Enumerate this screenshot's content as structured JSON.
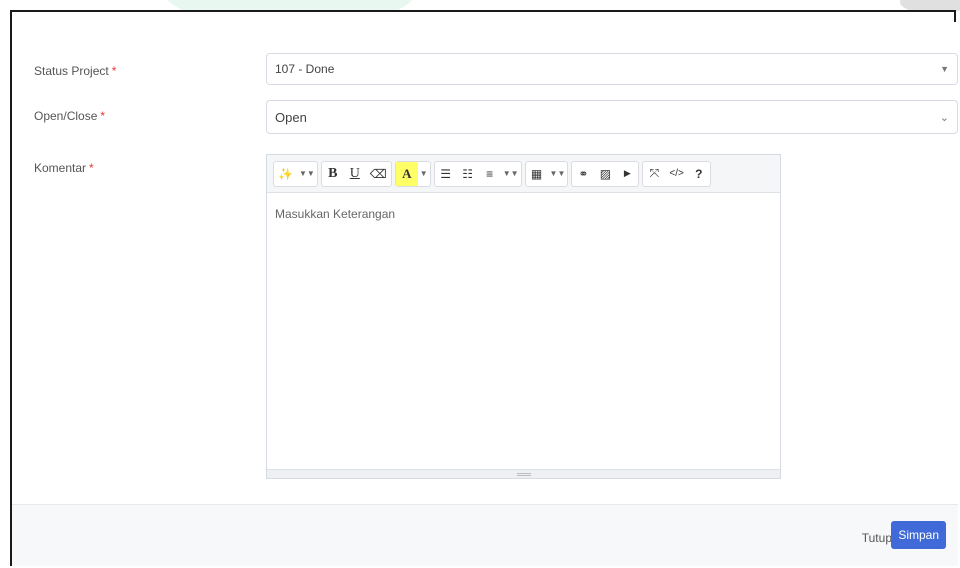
{
  "form": {
    "status_label": "Status Project",
    "status_value": "107 - Done",
    "openclose_label": "Open/Close",
    "openclose_value": "Open",
    "komentar_label": "Komentar",
    "required_mark": "*"
  },
  "editor": {
    "placeholder": "Masukkan Keterangan",
    "toolbar": {
      "style": "✨",
      "bold": "B",
      "underline": "U",
      "eraser": "⌫",
      "highlight": "A",
      "ul": "☰",
      "ol": "☷",
      "align": "≡",
      "table": "▦",
      "link": "⚭",
      "image": "▨",
      "video": "▶",
      "fullscreen": "⤧",
      "code": "</>",
      "help": "?"
    }
  },
  "footer": {
    "close_label": "Tutup",
    "save_label": "Simpan"
  },
  "colors": {
    "primary": "#3f6ad8",
    "required": "#e53935",
    "highlight": "#ffff66"
  }
}
